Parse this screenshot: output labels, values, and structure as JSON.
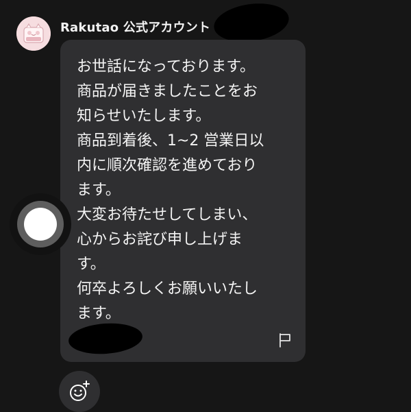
{
  "sender": {
    "name": "Rakutao 公式アカウント"
  },
  "message": {
    "text": "お世話になっております。\n商品が届きましたことをお\n知らせいたします。\n商品到着後、1~2 営業日以\n内に順次確認を進めており\nます。\n大変お待たせしてしまい、\n心からお詫び申し上げま\nす。\n何卒よろしくお願いいたし\nます。"
  },
  "colors": {
    "background": "#161616",
    "bubble": "#2f2f31",
    "text": "#f4f4f4"
  },
  "icons": {
    "flag": "flag-icon",
    "reaction": "add-reaction-icon",
    "assistive_touch": "assistive-touch-icon"
  }
}
